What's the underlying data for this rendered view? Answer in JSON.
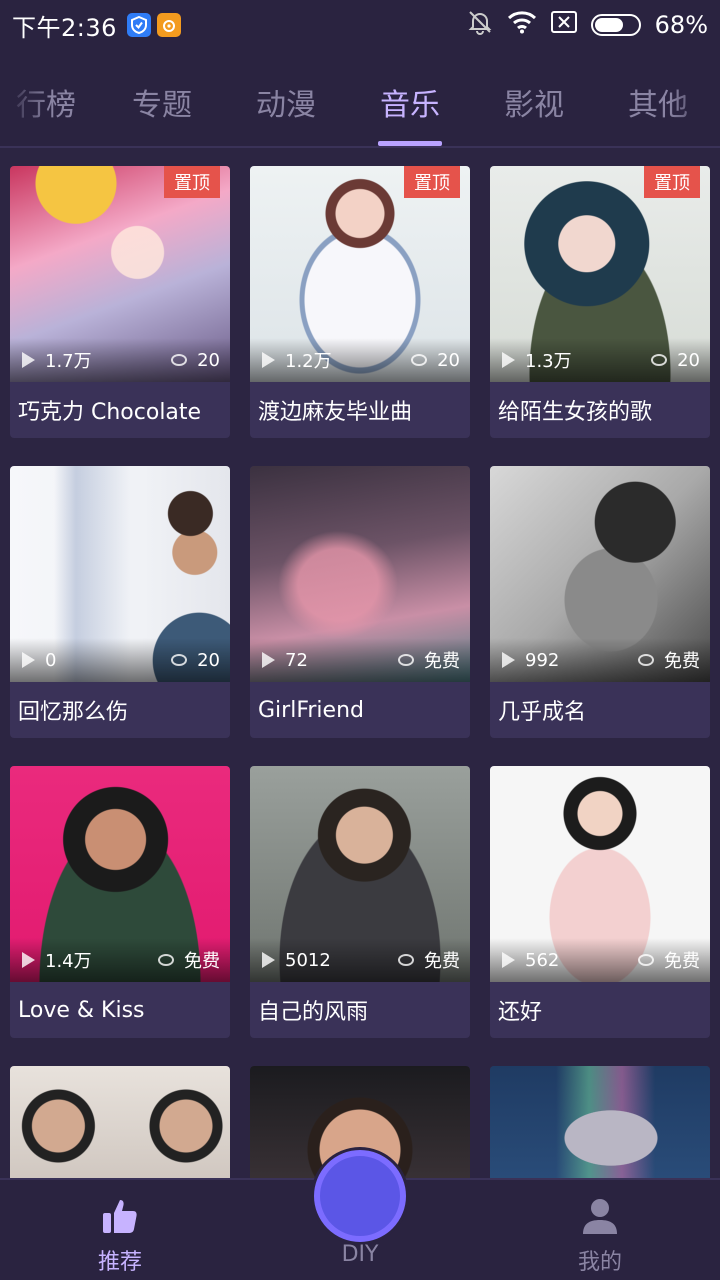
{
  "status_bar": {
    "time": "下午2:36",
    "battery": "68%",
    "battery_level": 0.68,
    "icons": [
      "shield-app-icon",
      "uc-app-icon",
      "mute-bell-icon",
      "wifi-icon",
      "no-sim-icon",
      "battery-icon"
    ]
  },
  "tabs": [
    {
      "label": "行榜",
      "active": false
    },
    {
      "label": "专题",
      "active": false
    },
    {
      "label": "动漫",
      "active": false
    },
    {
      "label": "音乐",
      "active": true
    },
    {
      "label": "影视",
      "active": false
    },
    {
      "label": "其他",
      "active": false
    }
  ],
  "cards": [
    {
      "title": "巧克力 Chocolate",
      "plays": "1.7万",
      "price": "20",
      "pinned": true,
      "pin_label": "置顶"
    },
    {
      "title": "渡边麻友毕业曲",
      "plays": "1.2万",
      "price": "20",
      "pinned": true,
      "pin_label": "置顶"
    },
    {
      "title": "给陌生女孩的歌",
      "plays": "1.3万",
      "price": "20",
      "pinned": true,
      "pin_label": "置顶"
    },
    {
      "title": "回忆那么伤",
      "plays": "0",
      "price": "20",
      "pinned": false
    },
    {
      "title": "GirlFriend",
      "plays": "72",
      "price": "免费",
      "pinned": false
    },
    {
      "title": "几乎成名",
      "plays": "992",
      "price": "免费",
      "pinned": false
    },
    {
      "title": "Love & Kiss",
      "plays": "1.4万",
      "price": "免费",
      "pinned": false
    },
    {
      "title": "自己的风雨",
      "plays": "5012",
      "price": "免费",
      "pinned": false
    },
    {
      "title": "还好",
      "plays": "562",
      "price": "免费",
      "pinned": false
    }
  ],
  "bottom_nav": {
    "recommend": "推荐",
    "diy": "DIY",
    "mine": "我的"
  },
  "colors": {
    "background": "#2c2542",
    "card": "#3a3258",
    "accent": "#c7b3ff",
    "pin": "#e5534b",
    "diy_button": "#5b56e6"
  }
}
